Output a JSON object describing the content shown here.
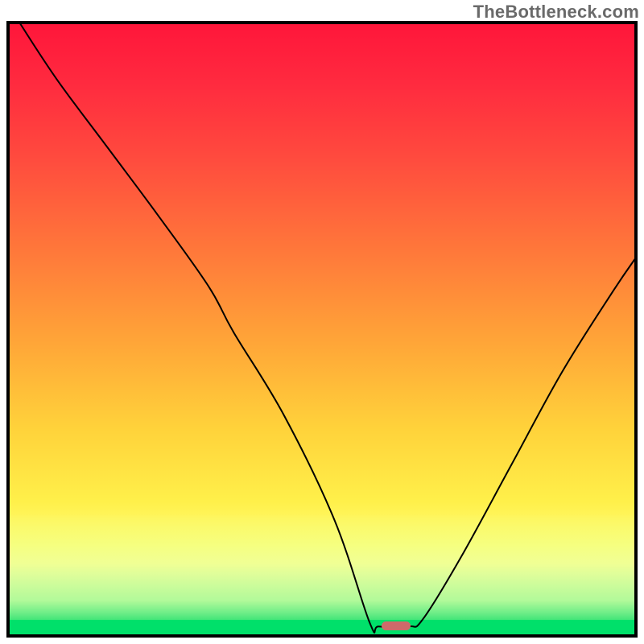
{
  "watermark": "TheBottleneck.com",
  "chart_data": {
    "type": "line",
    "title": "",
    "xlabel": "",
    "ylabel": "",
    "xlim": [
      0,
      100
    ],
    "ylim": [
      0,
      100
    ],
    "grid": false,
    "legend": false,
    "series": [
      {
        "name": "curve",
        "x": [
          1.9,
          8,
          16,
          24,
          32,
          36,
          44,
          52,
          57.6,
          59,
          63.8,
          66,
          72,
          80,
          88,
          96,
          100
        ],
        "y": [
          100,
          90.5,
          79.5,
          68.5,
          57,
          49.5,
          36,
          19,
          2.3,
          1.8,
          1.8,
          3,
          13,
          28,
          43,
          56,
          62
        ]
      }
    ],
    "marker": {
      "x": 61.7,
      "y": 1.9,
      "width_pct": 4.6,
      "height_pct": 1.4,
      "color": "#ce6a6a"
    },
    "background_gradient": {
      "stops": [
        {
          "pos": 0.0,
          "color": "#ff153a"
        },
        {
          "pos": 0.52,
          "color": "#ffa538"
        },
        {
          "pos": 0.85,
          "color": "#ffff7a"
        },
        {
          "pos": 0.95,
          "color": "#d8fbb4"
        },
        {
          "pos": 0.971,
          "color": "#00e06a"
        },
        {
          "pos": 1.0,
          "color": "#00e06a"
        }
      ]
    }
  }
}
